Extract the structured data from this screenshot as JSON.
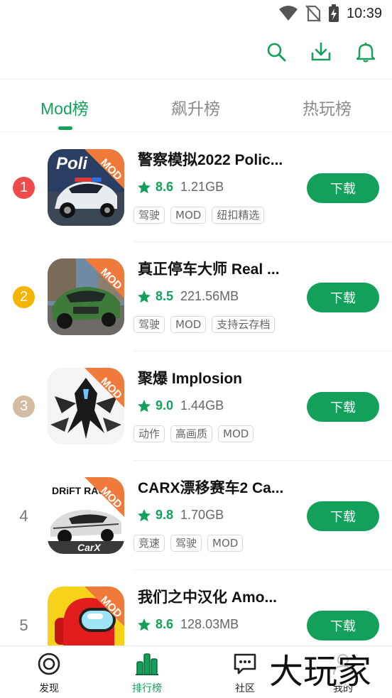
{
  "status_bar": {
    "time": "10:39",
    "icons": [
      "wifi-icon",
      "no-sim-icon",
      "battery-charging-icon"
    ]
  },
  "header": {
    "icons": [
      "search-icon",
      "download-icon",
      "bell-icon"
    ]
  },
  "tabs": [
    {
      "label": "Mod榜",
      "active": true
    },
    {
      "label": "飙升榜",
      "active": false
    },
    {
      "label": "热玩榜",
      "active": false
    }
  ],
  "accent_color": "#12a05a",
  "rank_colors": [
    "#ef4b4b",
    "#f5b400",
    "#d2bda3"
  ],
  "items": [
    {
      "rank": "1",
      "title": "警察模拟2022 Polic...",
      "score": "8.6",
      "size": "1.21GB",
      "tags": [
        "驾驶",
        "MOD",
        "纽扣精选"
      ],
      "download_label": "下载",
      "badge": "MOD",
      "icon_name": "police-car-game-icon"
    },
    {
      "rank": "2",
      "title": "真正停车大师 Real ...",
      "score": "8.5",
      "size": "221.56MB",
      "tags": [
        "驾驶",
        "MOD",
        "支持云存档"
      ],
      "download_label": "下载",
      "badge": "MOD",
      "icon_name": "green-car-game-icon"
    },
    {
      "rank": "3",
      "title": "聚爆 Implosion",
      "score": "9.0",
      "size": "1.44GB",
      "tags": [
        "动作",
        "高画质",
        "MOD"
      ],
      "download_label": "下载",
      "badge": "MOD",
      "icon_name": "mech-robot-game-icon"
    },
    {
      "rank": "4",
      "title": "CARX漂移赛车2 Ca...",
      "score": "9.8",
      "size": "1.70GB",
      "tags": [
        "竞速",
        "驾驶",
        "MOD"
      ],
      "download_label": "下载",
      "badge": "MOD",
      "icon_name": "drift-racing-game-icon",
      "icon_text": "DRiFT RACING",
      "icon_brand": "CarX"
    },
    {
      "rank": "5",
      "title": "我们之中汉化 Amo...",
      "score": "8.6",
      "size": "128.03MB",
      "tags": [
        "",
        "",
        ""
      ],
      "download_label": "下载",
      "badge": "MOD",
      "icon_name": "among-us-game-icon"
    }
  ],
  "bottom_nav": [
    {
      "label": "发现",
      "icon": "discover-icon",
      "active": false
    },
    {
      "label": "排行榜",
      "icon": "ranking-icon",
      "active": true
    },
    {
      "label": "社区",
      "icon": "community-icon",
      "active": false
    },
    {
      "label": "我的",
      "icon": "profile-icon",
      "active": false
    }
  ],
  "watermark": {
    "text": "大玩家"
  }
}
